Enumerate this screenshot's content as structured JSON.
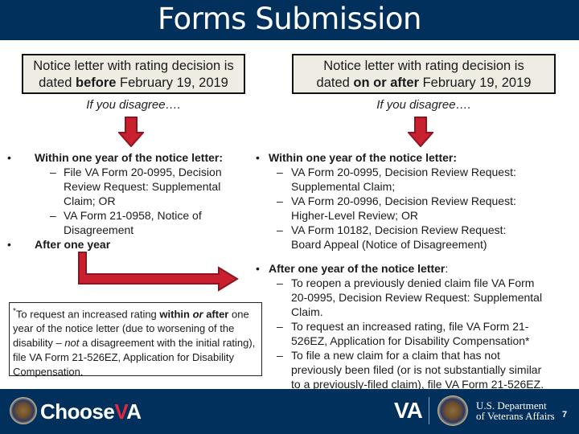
{
  "title": "Forms Submission",
  "left_column": {
    "header_line1": "Notice letter with rating decision is",
    "header_prefix": "dated ",
    "header_bold": "before",
    "header_suffix": " February 19, 2019",
    "disagree": "If you disagree….",
    "bullets": [
      {
        "label": "Within one year of the notice letter:",
        "subs": [
          [
            "File VA Form 20-0995, Decision",
            "Review Request: Supplemental",
            "Claim; OR"
          ],
          [
            "VA Form 21-0958, Notice of",
            "Disagreement"
          ]
        ]
      },
      {
        "label": "After one year",
        "subs": []
      }
    ]
  },
  "right_column": {
    "header_line1": "Notice letter with rating decision is",
    "header_prefix": "dated ",
    "header_bold": "on or after",
    "header_suffix": " February 19, 2019",
    "disagree": "If you disagree….",
    "bullets": [
      {
        "label": "Within one year of the notice letter:",
        "label_suffix": "",
        "subs": [
          [
            "VA Form 20-0995, Decision Review Request:",
            "Supplemental Claim;"
          ],
          [
            "VA Form 20-0996, Decision Review Request:",
            "Higher-Level Review; OR"
          ],
          [
            "VA Form 10182, Decision Review Request:",
            "Board Appeal (Notice of Disagreement)"
          ]
        ]
      },
      {
        "label": "After one year of the notice letter",
        "label_suffix": ":",
        "subs": [
          [
            "To reopen a previously denied claim file VA Form",
            "20-0995, Decision Review Request: Supplemental",
            "Claim."
          ],
          [
            "To request an increased rating, file VA Form 21-",
            "526EZ, Application for Disability Compensation*"
          ],
          [
            "To file a new claim for a claim that has not",
            "previously been filed (or is not substantially similar",
            "to a previously-filed claim), file VA Form 21-526EZ."
          ]
        ]
      }
    ]
  },
  "note": {
    "asterisk": "*",
    "part1": "To request an increased rating ",
    "bold1": "within ",
    "bold_italic": "or",
    "bold2": " after",
    "part2": " one year of the notice letter (due to worsening of the disability – ",
    "italic": "not",
    "part3": " a disagreement with the initial rating), file VA Form 21-526EZ, Application for Disability Compensation."
  },
  "footer": {
    "brand_choose": "Choose",
    "brand_v": "V",
    "brand_a": "A",
    "va_logo": "VA",
    "dept_line1": "U.S. Department",
    "dept_line2": "of Veterans Affairs",
    "page_number": "7"
  },
  "colors": {
    "header_bg": "#00305b",
    "box_bg": "#eeece3",
    "arrow_red": "#c8202f",
    "arrow_dark": "#8e1420",
    "brand_red": "#e3253e"
  }
}
